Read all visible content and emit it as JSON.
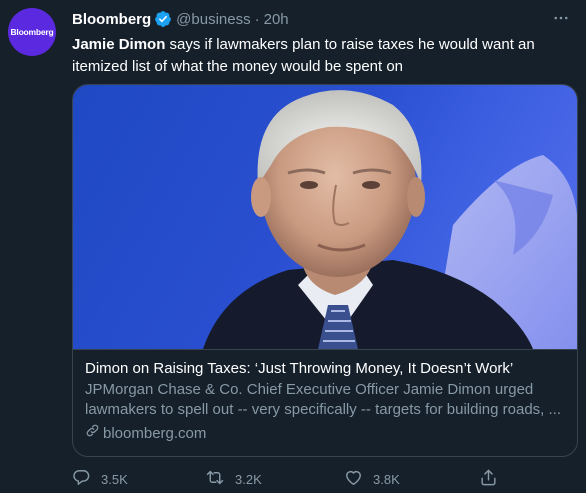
{
  "tweet": {
    "avatar_text": "Bloomberg",
    "display_name": "Bloomberg",
    "handle": "@business",
    "separator": "·",
    "time": "20h",
    "mention": "Jamie Dimon",
    "text": " says if lawmakers plan to raise taxes he would want an itemized list of what the money would be spent on"
  },
  "card": {
    "title": "Dimon on Raising Taxes: ‘Just Throwing Money, It Doesn’t Work’",
    "description": "JPMorgan Chase & Co. Chief Executive Officer Jamie Dimon urged lawmakers to spell out -- very specifically -- targets for building roads, ...",
    "domain": "bloomberg.com"
  },
  "actions": {
    "replies": "3.5K",
    "retweets": "3.2K",
    "likes": "3.8K"
  },
  "icons": {
    "verified": "verified-badge-icon",
    "more": "more-icon",
    "reply": "reply-icon",
    "retweet": "retweet-icon",
    "like": "heart-icon",
    "share": "share-icon",
    "link": "link-icon"
  },
  "colors": {
    "background": "#15202b",
    "secondary_text": "#8899a6",
    "border": "#38444d",
    "verified": "#1da1f2",
    "avatar_bg": "#5b2ae0"
  }
}
